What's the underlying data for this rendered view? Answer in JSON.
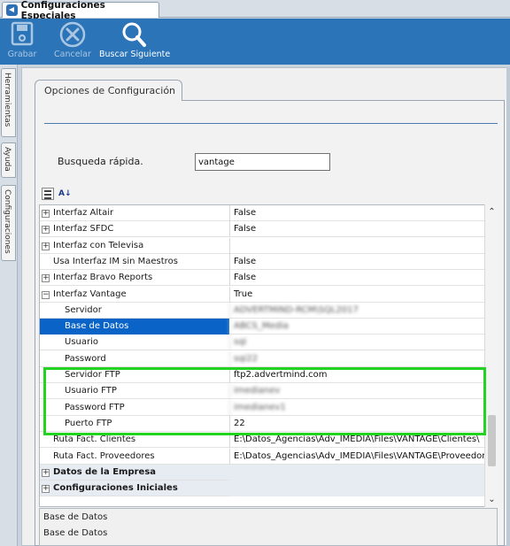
{
  "window": {
    "tab_title": "Configuraciones Especiales"
  },
  "toolbar": {
    "save_label": "Grabar",
    "cancel_label": "Cancelar",
    "find_next_label": "Buscar Siguiente"
  },
  "side_tabs": [
    "Herramientas",
    "Ayuda",
    "Configuraciones"
  ],
  "options": {
    "tab_label": "Opciones de Configuración",
    "search_label": "Busqueda rápida.",
    "search_value": "vantage"
  },
  "grid": {
    "rows": [
      {
        "name": "Interfaz Altair",
        "value": "False",
        "expander": "+"
      },
      {
        "name": "Interfaz SFDC",
        "value": "False",
        "expander": "+"
      },
      {
        "name": "Interfaz con Televisa",
        "value": "",
        "expander": "+"
      },
      {
        "name": "Usa Interfaz IM sin Maestros",
        "value": "False",
        "expander": ""
      },
      {
        "name": "Interfaz Bravo Reports",
        "value": "False",
        "expander": "+"
      },
      {
        "name": "Interfaz Vantage",
        "value": "True",
        "expander": "−"
      },
      {
        "name": "Servidor",
        "value": "ADVERTMIND-RCM\\SQL2017",
        "blur": true
      },
      {
        "name": "Base de Datos",
        "value": "ABCS_Media",
        "blur": true,
        "selected": true
      },
      {
        "name": "Usuario",
        "value": "sqi",
        "blur": true
      },
      {
        "name": "Password",
        "value": "sqi22",
        "blur": true
      },
      {
        "name": "Servidor FTP",
        "value": "ftp2.advertmind.com"
      },
      {
        "name": "Usuario FTP",
        "value": "imedianev",
        "blur": true
      },
      {
        "name": "Password FTP",
        "value": "imedianev1",
        "blur": true
      },
      {
        "name": "Puerto FTP",
        "value": "22"
      },
      {
        "name": "Ruta Fact. Clientes",
        "value": "E:\\Datos_Agencias\\Adv_IMEDIA\\Files\\VANTAGE\\Clientes\\"
      },
      {
        "name": "Ruta Fact. Proveedores",
        "value": "E:\\Datos_Agencias\\Adv_IMEDIA\\Files\\VANTAGE\\Proveedores\\"
      },
      {
        "name": "Datos de la Empresa",
        "value": "",
        "expander": "+"
      },
      {
        "name": "Configuraciones Iniciales",
        "value": "",
        "expander": "+"
      }
    ]
  },
  "description": {
    "title": "Base de Datos",
    "text": "Base de Datos"
  }
}
